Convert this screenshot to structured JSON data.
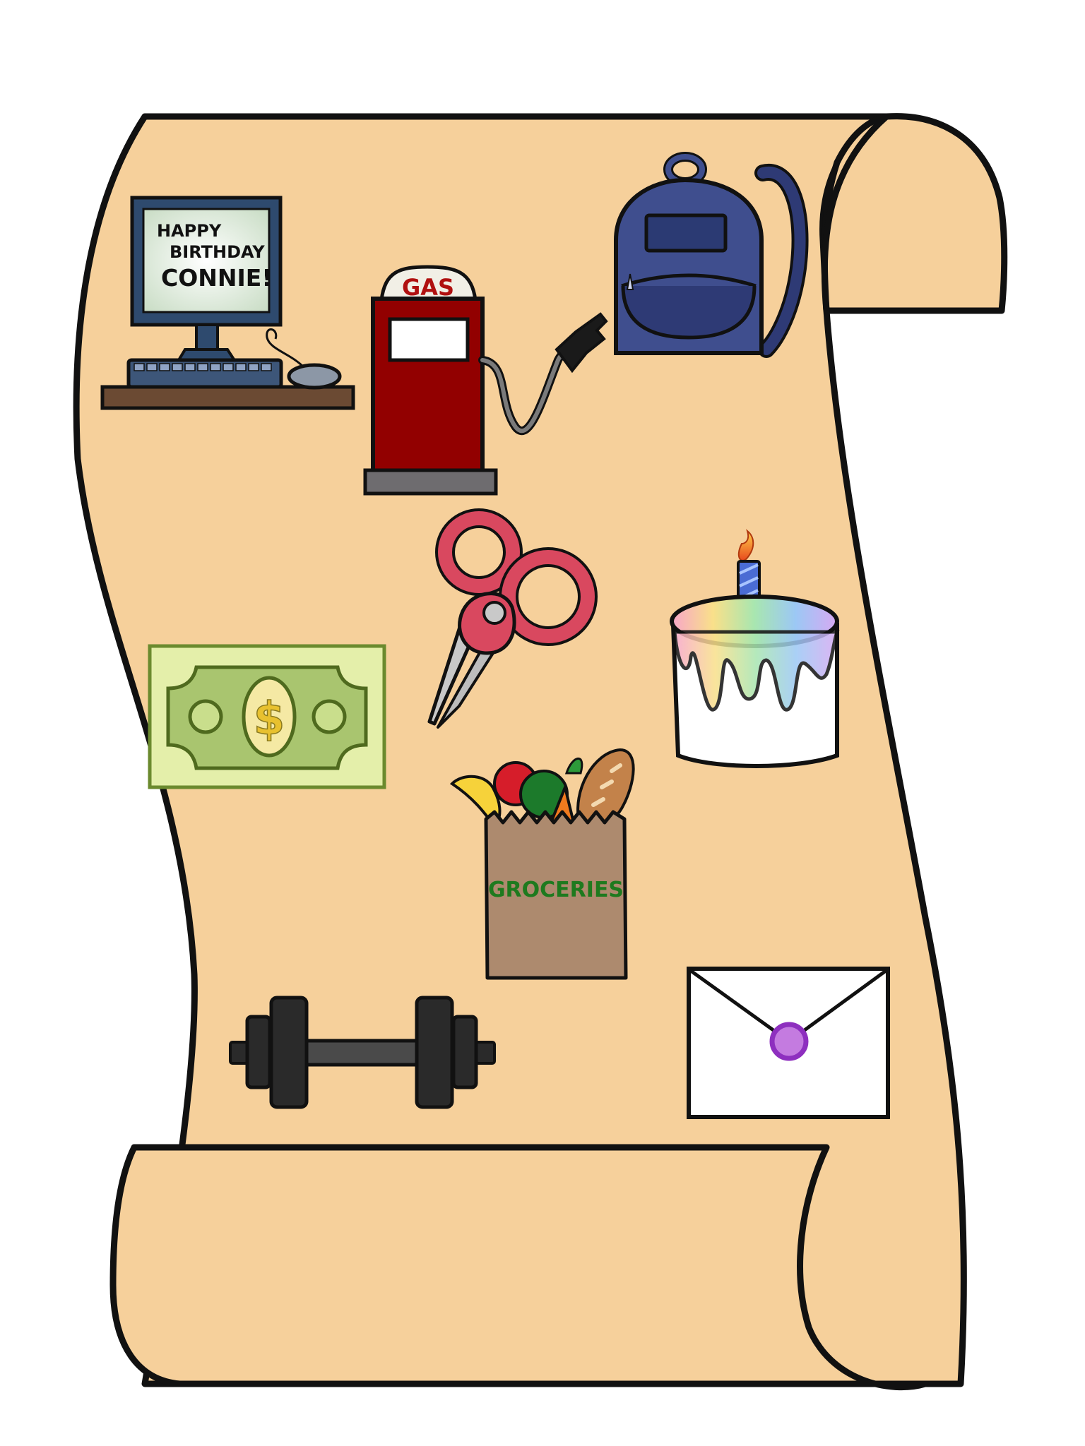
{
  "colors": {
    "parchment": "#f6d09b",
    "outline": "#111111",
    "gas_red": "#920000",
    "backpack": "#3f4e8e",
    "money": "#a9c56f",
    "money_dark": "#4f6a1e",
    "groceries_text": "#1e7a1e",
    "scissors": "#d9485f",
    "envelope_seal": "#c47be0"
  },
  "items": {
    "computer": {
      "icon": "computer-icon",
      "screen_line1": "HAPPY",
      "screen_line2": "BIRTHDAY",
      "screen_line3": "CONNIE!"
    },
    "gas_pump": {
      "icon": "gas-pump-icon",
      "label": "GAS"
    },
    "backpack": {
      "icon": "backpack-icon"
    },
    "scissors": {
      "icon": "scissors-icon"
    },
    "cake": {
      "icon": "birthday-cake-icon"
    },
    "money": {
      "icon": "dollar-bill-icon",
      "symbol": "$"
    },
    "groceries": {
      "icon": "grocery-bag-icon",
      "label": "GROCERIES"
    },
    "dumbbell": {
      "icon": "dumbbell-icon"
    },
    "envelope": {
      "icon": "envelope-icon"
    }
  }
}
